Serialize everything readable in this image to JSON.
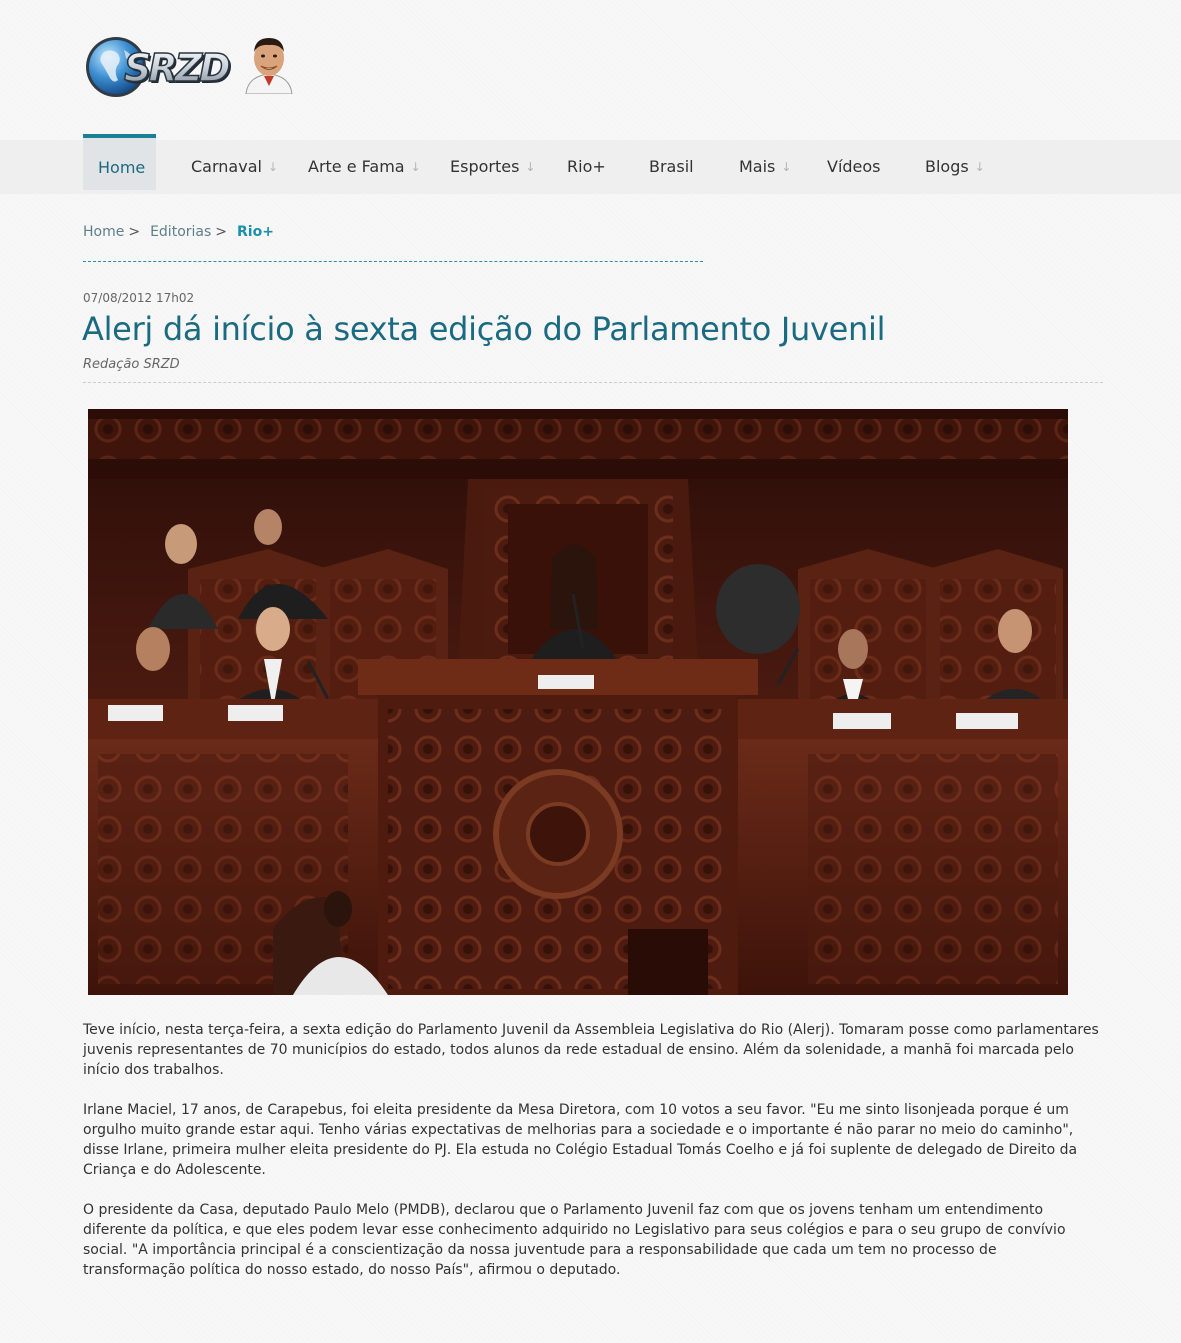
{
  "brand": {
    "logo_text": "SRZD"
  },
  "nav": {
    "items": [
      {
        "label": "Home",
        "active": true,
        "has_submenu": false
      },
      {
        "label": "Carnaval",
        "active": false,
        "has_submenu": true
      },
      {
        "label": "Arte e Fama",
        "active": false,
        "has_submenu": true
      },
      {
        "label": "Esportes",
        "active": false,
        "has_submenu": true
      },
      {
        "label": "Rio+",
        "active": false,
        "has_submenu": false
      },
      {
        "label": "Brasil",
        "active": false,
        "has_submenu": false
      },
      {
        "label": "Mais",
        "active": false,
        "has_submenu": true
      },
      {
        "label": "Vídeos",
        "active": false,
        "has_submenu": false
      },
      {
        "label": "Blogs",
        "active": false,
        "has_submenu": true
      }
    ],
    "submenu_icon": "arrow-down-icon"
  },
  "breadcrumb": {
    "items": [
      "Home",
      "Editorias"
    ],
    "separator": ">",
    "current": "Rio+"
  },
  "article": {
    "date": "07/08/2012 17h02",
    "title": "Alerj dá início à sexta edição do Parlamento Juvenil",
    "author": "Redação SRZD",
    "paragraphs": [
      "Teve início, nesta terça-feira, a sexta edição do Parlamento Juvenil da Assembleia  Legislativa do Rio (Alerj). Tomaram posse como parlamentares juvenis  representantes de 70 municípios do estado, todos alunos da rede estadual de ensino. Além da solenidade, a manhã foi marcada pelo início dos trabalhos.",
      "Irlane Maciel, 17 anos, de Carapebus, foi eleita presidente da Mesa Diretora, com 10 votos a seu favor. \"Eu me sinto lisonjeada porque é um orgulho muito grande estar aqui. Tenho várias expectativas de melhorias para a sociedade e o importante é não parar no meio do caminho\", disse Irlane, primeira mulher eleita presidente do PJ. Ela estuda no Colégio Estadual Tomás Coelho e já foi suplente de delegado de Direito da Criança e do Adolescente.",
      "O presidente da Casa, deputado Paulo Melo (PMDB), declarou que o Parlamento Juvenil faz com que os jovens tenham um entendimento diferente da política, e que eles podem levar esse conhecimento adquirido no Legislativo para seus colégios e para o seu grupo de convívio social. \"A importância principal é a conscientização da nossa juventude para a responsabilidade que cada um tem no processo de transformação política do nosso estado, do nosso País\", afirmou o deputado."
    ]
  },
  "colors": {
    "accent": "#1a6a82",
    "nav_bg": "#efefef",
    "active_tab_border": "#1d7f96"
  }
}
